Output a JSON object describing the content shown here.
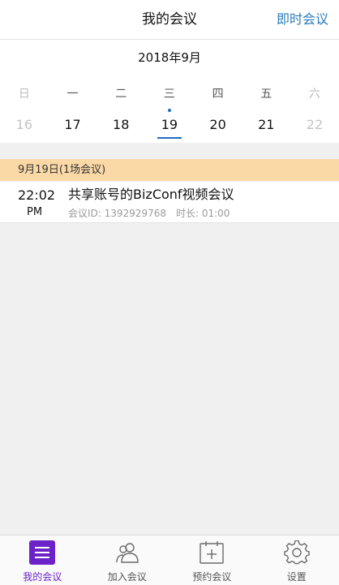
{
  "header": {
    "title": "我的会议",
    "action_label": "即时会议"
  },
  "calendar": {
    "month_label": "2018年9月",
    "weekdays": [
      "日",
      "一",
      "二",
      "三",
      "四",
      "五",
      "六"
    ],
    "dates": [
      "16",
      "17",
      "18",
      "19",
      "20",
      "21",
      "22"
    ],
    "selected_date": "19"
  },
  "day_group": {
    "header": "9月19日(1场会议)",
    "meetings": [
      {
        "time": "22:02",
        "ampm": "PM",
        "title": "共享账号的BizConf视频会议",
        "meeting_id": "会议ID: 1392929768",
        "duration": "时长: 01:00"
      }
    ]
  },
  "tabs": [
    {
      "label": "我的会议",
      "icon": "menu-icon",
      "active": true
    },
    {
      "label": "加入会议",
      "icon": "people-icon",
      "active": false
    },
    {
      "label": "预约会议",
      "icon": "calendar-add-icon",
      "active": false
    },
    {
      "label": "设置",
      "icon": "gear-icon",
      "active": false
    }
  ],
  "colors": {
    "accent": "#6b23c7",
    "link": "#2b7bb9",
    "highlight": "#fbd9a6",
    "selected": "#1f6bbd"
  }
}
